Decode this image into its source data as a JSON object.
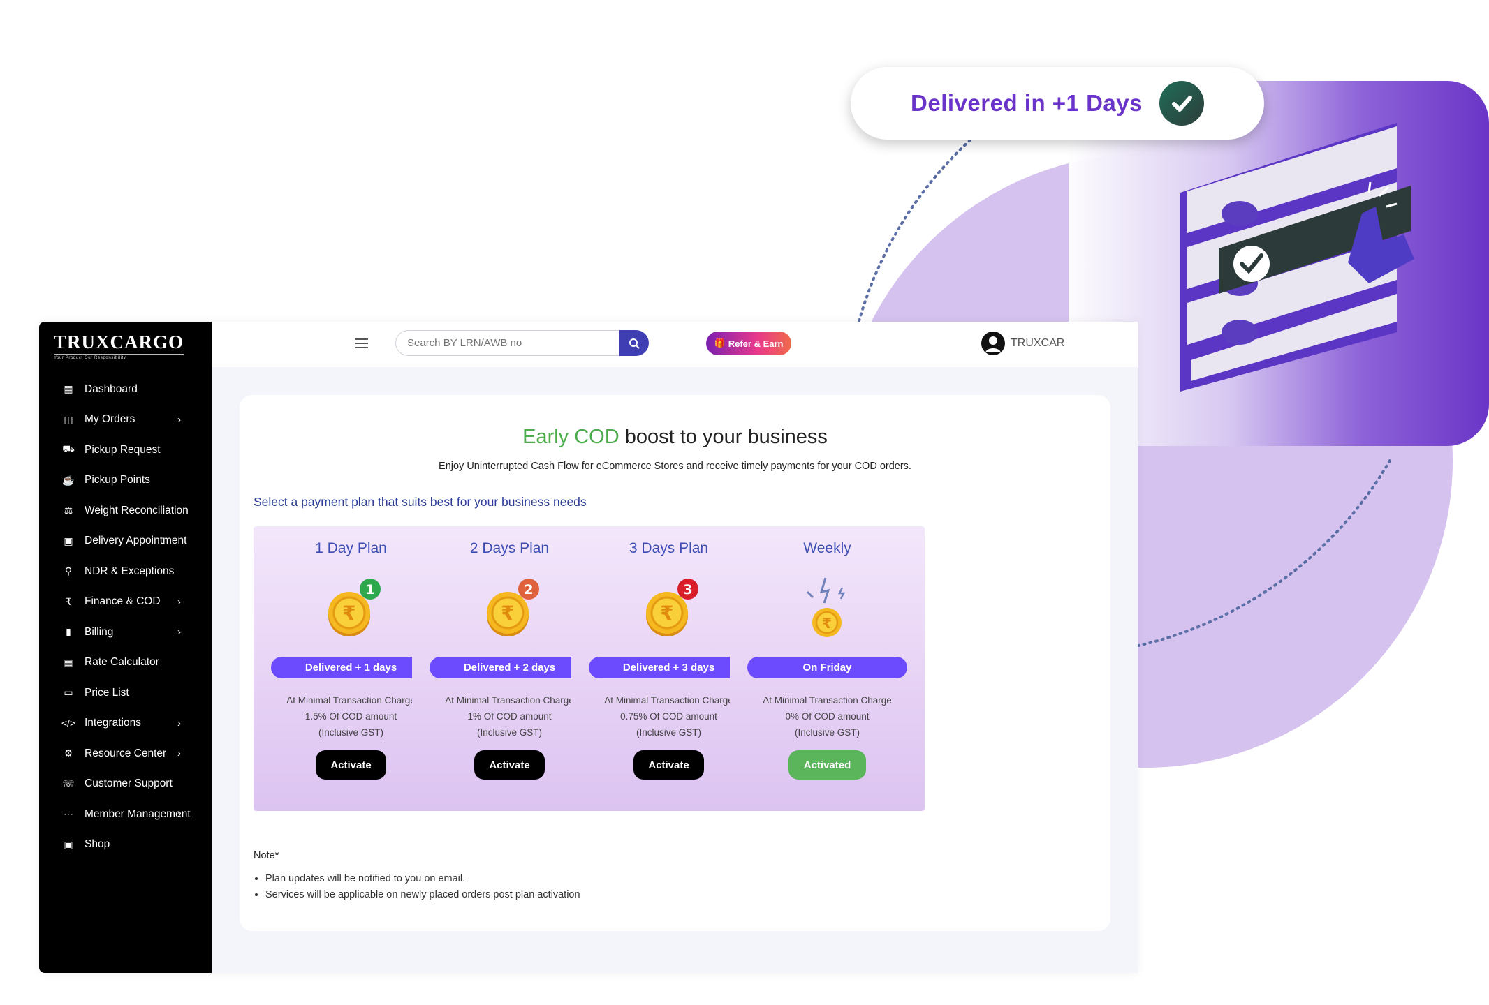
{
  "badge": {
    "text": "Delivered  in +1 Days",
    "icon": "check-circle-icon"
  },
  "colors": {
    "accent_purple": "#6a33c9",
    "accent_green": "#4cab4a",
    "pill_violet": "#6c4bff",
    "sidebar_bg": "#000000",
    "activated_green": "#5bb55b"
  },
  "logo": {
    "text": "TRUXCARGO",
    "tagline": "Your Product Our Responsibility"
  },
  "sidebar": {
    "items": [
      {
        "label": "Dashboard",
        "icon": "grid-icon",
        "chevron": false
      },
      {
        "label": "My Orders",
        "icon": "orders-icon",
        "chevron": true
      },
      {
        "label": "Pickup Request",
        "icon": "truck-icon",
        "chevron": false
      },
      {
        "label": "Pickup Points",
        "icon": "bank-icon",
        "chevron": false
      },
      {
        "label": "Weight Reconciliation",
        "icon": "scale-icon",
        "chevron": false
      },
      {
        "label": "Delivery Appointment",
        "icon": "calendar-icon",
        "chevron": false
      },
      {
        "label": "NDR & Exceptions",
        "icon": "pin-icon",
        "chevron": false
      },
      {
        "label": "Finance & COD",
        "icon": "rupee-icon",
        "chevron": true
      },
      {
        "label": "Billing",
        "icon": "bars-icon",
        "chevron": true
      },
      {
        "label": "Rate Calculator",
        "icon": "calculator-icon",
        "chevron": false
      },
      {
        "label": "Price List",
        "icon": "card-icon",
        "chevron": false
      },
      {
        "label": "Integrations",
        "icon": "code-icon",
        "chevron": true
      },
      {
        "label": "Resource Center",
        "icon": "gear-icon",
        "chevron": true
      },
      {
        "label": "Customer Support",
        "icon": "headset-icon",
        "chevron": false
      },
      {
        "label": "Member Management",
        "icon": "members-icon",
        "chevron": true
      },
      {
        "label": "Shop",
        "icon": "briefcase-icon",
        "chevron": false
      }
    ]
  },
  "topbar": {
    "search_placeholder": "Search BY LRN/AWB no",
    "refer_label": "Refer & Earn",
    "user_name": "TRUXCAR"
  },
  "main": {
    "headline_accent": "Early COD",
    "headline_rest": " boost to your business",
    "subheadline": "Enjoy Uninterrupted Cash Flow for eCommerce Stores and receive timely payments for your COD orders.",
    "select_prompt": "Select a payment plan that suits best for your business needs",
    "plans": [
      {
        "title": "1 Day Plan",
        "badge": "Delivered + 1 days",
        "line1": "At Minimal Transaction Charge",
        "line2": "1.5% Of COD amount",
        "line3": "(Inclusive GST)",
        "button": "Activate",
        "coin_number": "1",
        "coin_badge_color": "#2ea84d"
      },
      {
        "title": "2 Days Plan",
        "badge": "Delivered + 2 days",
        "line1": "At Minimal Transaction Charge",
        "line2": "1% Of COD amount",
        "line3": "(Inclusive GST)",
        "button": "Activate",
        "coin_number": "2",
        "coin_badge_color": "#e0623c"
      },
      {
        "title": "3 Days Plan",
        "badge": "Delivered + 3 days",
        "line1": "At Minimal Transaction Charge",
        "line2": "0.75% Of COD amount",
        "line3": "(Inclusive GST)",
        "button": "Activate",
        "coin_number": "3",
        "coin_badge_color": "#d91e2a"
      },
      {
        "title": "Weekly",
        "badge": "On Friday",
        "line1": "At Minimal Transaction Charge",
        "line2": "0% Of COD amount",
        "line3": "(Inclusive GST)",
        "button": "Activated",
        "coin_number": "",
        "coin_badge_color": ""
      }
    ],
    "note_title": "Note*",
    "notes": [
      "Plan updates will be notified to you on email.",
      "Services will be applicable on newly placed orders post plan activation"
    ]
  }
}
